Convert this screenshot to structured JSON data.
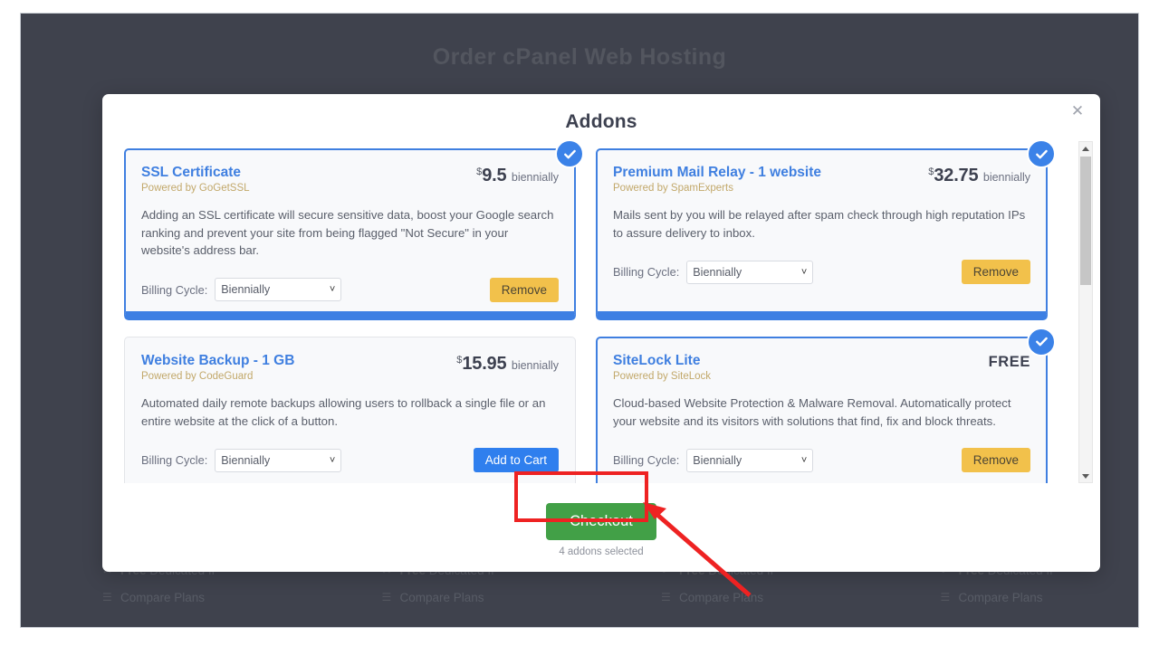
{
  "page": {
    "title": "Order cPanel Web Hosting"
  },
  "modal": {
    "title": "Addons",
    "close_icon": "close-icon",
    "checkout_label": "Checkout",
    "selected_count_text": "4 addons selected",
    "selected_badge_icon": "check-circle-icon"
  },
  "colors": {
    "page_background": "#3f424d",
    "accent_blue": "#3f7fe0",
    "selected_border": "#3d7fe3",
    "remove_button": "#f2c14b",
    "add_button": "#2f7fee",
    "checkout_button": "#42a047",
    "powered_by": "#c2a86a",
    "annotation_red": "#ee2222"
  },
  "addons": [
    {
      "name": "SSL Certificate",
      "powered_by": "Powered by GoGetSSL",
      "currency": "$",
      "price": "9.5",
      "cycle": "biennially",
      "is_free": false,
      "description": "Adding an SSL certificate will secure sensitive data, boost your Google search ranking and prevent your site from being flagged \"Not Secure\" in your website's address bar.",
      "billing_label": "Billing Cycle:",
      "billing_value": "Biennially",
      "button_label": "Remove",
      "button_kind": "remove",
      "selected": true
    },
    {
      "name": "Premium Mail Relay - 1 website",
      "powered_by": "Powered by SpamExperts",
      "currency": "$",
      "price": "32.75",
      "cycle": "biennially",
      "is_free": false,
      "description": "Mails sent by you will be relayed after spam check through high reputation IPs to assure delivery to inbox.",
      "billing_label": "Billing Cycle:",
      "billing_value": "Biennially",
      "button_label": "Remove",
      "button_kind": "remove",
      "selected": true
    },
    {
      "name": "Website Backup - 1 GB",
      "powered_by": "Powered by CodeGuard",
      "currency": "$",
      "price": "15.95",
      "cycle": "biennially",
      "is_free": false,
      "description": "Automated daily remote backups allowing users to rollback a single file or an entire website at the click of a button.",
      "billing_label": "Billing Cycle:",
      "billing_value": "Biennially",
      "button_label": "Add to Cart",
      "button_kind": "add",
      "selected": false
    },
    {
      "name": "SiteLock Lite",
      "powered_by": "Powered by SiteLock",
      "currency": "",
      "price": "FREE",
      "cycle": "",
      "is_free": true,
      "description": "Cloud-based Website Protection & Malware Removal. Automatically protect your website and its visitors with solutions that find, fix and block threats.",
      "billing_label": "Billing Cycle:",
      "billing_value": "Biennially",
      "button_label": "Remove",
      "button_kind": "remove",
      "selected": true
    }
  ],
  "background_plans": [
    {
      "feature_mark": "✕",
      "feature_strong": "Free",
      "feature_rest": "Dedicated IP",
      "compare_label": "Compare Plans"
    },
    {
      "feature_mark": "✕",
      "feature_strong": "Free",
      "feature_rest": "Dedicated IP",
      "compare_label": "Compare Plans"
    },
    {
      "feature_mark": "✓",
      "feature_strong": "Free",
      "feature_rest": "Dedicated IP",
      "compare_label": "Compare Plans"
    },
    {
      "feature_mark": "✓",
      "feature_strong": "Free",
      "feature_rest": "Dedicated IP",
      "compare_label": "Compare Plans"
    }
  ],
  "scrollbar": {
    "up_icon": "chevron-up-icon",
    "down_icon": "chevron-down-icon"
  }
}
